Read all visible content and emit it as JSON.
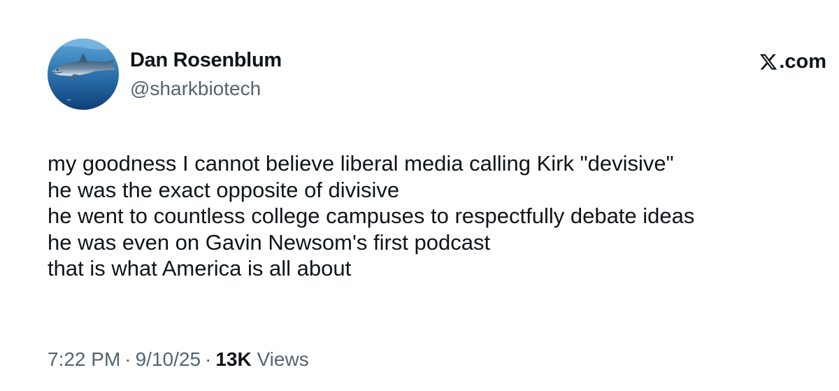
{
  "author": {
    "display_name": "Dan Rosenblum",
    "handle": "@sharkbiotech"
  },
  "brand": {
    "text": ".com",
    "icon": "x-logo-icon"
  },
  "tweet": {
    "lines": [
      "my goodness I cannot believe liberal media calling Kirk \"devisive\"",
      "he was the exact opposite of divisive",
      "he went to countless college campuses to respectfully debate ideas",
      "he was even on Gavin Newsom's first podcast",
      "that is what America is all about"
    ]
  },
  "meta": {
    "time": "7:22 PM",
    "separator": "·",
    "date": "9/10/25",
    "views_count": "13K",
    "views_label": "Views"
  },
  "colors": {
    "text_primary": "#0f1419",
    "text_secondary": "#536471"
  }
}
